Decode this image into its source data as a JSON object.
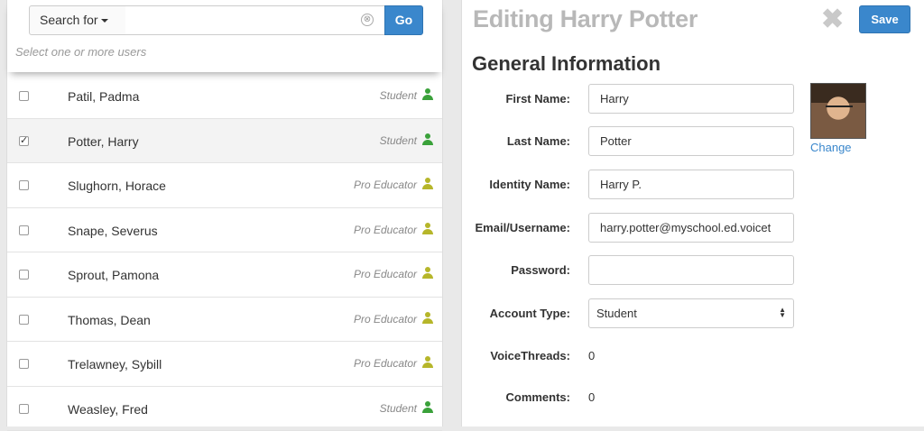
{
  "search": {
    "dropdown_label": "Search for",
    "input_value": "",
    "input_placeholder": "",
    "clear_icon": "⊗",
    "go_label": "Go",
    "hint": "Select one or more users"
  },
  "users": [
    {
      "name": "Patil, Padma",
      "role": "Student",
      "checked": false,
      "role_color": "#3aa13a"
    },
    {
      "name": "Potter, Harry",
      "role": "Student",
      "checked": true,
      "role_color": "#3aa13a"
    },
    {
      "name": "Slughorn, Horace",
      "role": "Pro Educator",
      "checked": false,
      "role_color": "#b6b62a"
    },
    {
      "name": "Snape, Severus",
      "role": "Pro Educator",
      "checked": false,
      "role_color": "#b6b62a"
    },
    {
      "name": "Sprout, Pamona",
      "role": "Pro Educator",
      "checked": false,
      "role_color": "#b6b62a"
    },
    {
      "name": "Thomas, Dean",
      "role": "Pro Educator",
      "checked": false,
      "role_color": "#b6b62a"
    },
    {
      "name": "Trelawney, Sybill",
      "role": "Pro Educator",
      "checked": false,
      "role_color": "#b6b62a"
    },
    {
      "name": "Weasley, Fred",
      "role": "Student",
      "checked": false,
      "role_color": "#3aa13a"
    }
  ],
  "editor": {
    "title": "Editing Harry Potter",
    "close_icon": "✖",
    "save_label": "Save",
    "section_title": "General Information",
    "change_label": "Change",
    "fields": {
      "first_name": {
        "label": "First Name:",
        "value": "Harry"
      },
      "last_name": {
        "label": "Last Name:",
        "value": "Potter"
      },
      "identity_name": {
        "label": "Identity Name:",
        "value": "Harry P."
      },
      "email": {
        "label": "Email/Username:",
        "value": "harry.potter@myschool.ed.voicet"
      },
      "password": {
        "label": "Password:",
        "value": ""
      },
      "account_type": {
        "label": "Account Type:",
        "value": "Student"
      },
      "voicethreads": {
        "label": "VoiceThreads:",
        "value": "0"
      },
      "comments": {
        "label": "Comments:",
        "value": "0"
      }
    }
  },
  "colors": {
    "accent": "#3a87cc",
    "student": "#3aa13a",
    "pro_educator": "#b6b62a"
  }
}
